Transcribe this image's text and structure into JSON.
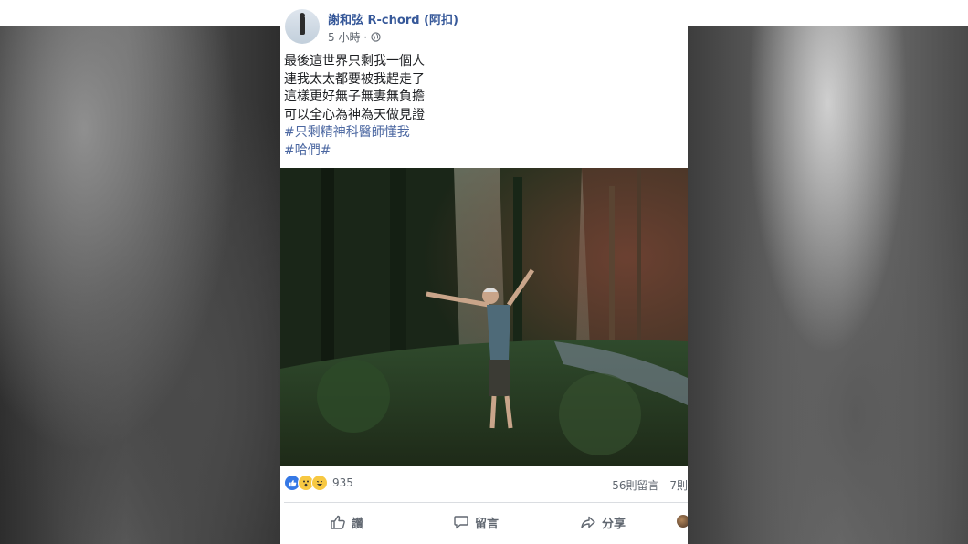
{
  "post": {
    "author": "謝和弦 R-chord (阿扣)",
    "time": "5 小時 ·",
    "lines": [
      "最後這世界只剩我一個人",
      "連我太太都要被我趕走了",
      "這樣更好無子無妻無負擔",
      "可以全心為神為天做見證"
    ],
    "hashtags": [
      "#只剩精神科醫師懂我",
      "#哈們#"
    ]
  },
  "reactions": {
    "count": "935",
    "comments": "56則留言",
    "shares": "7則"
  },
  "actions": {
    "like": "讚",
    "comment": "留言",
    "share": "分享"
  }
}
